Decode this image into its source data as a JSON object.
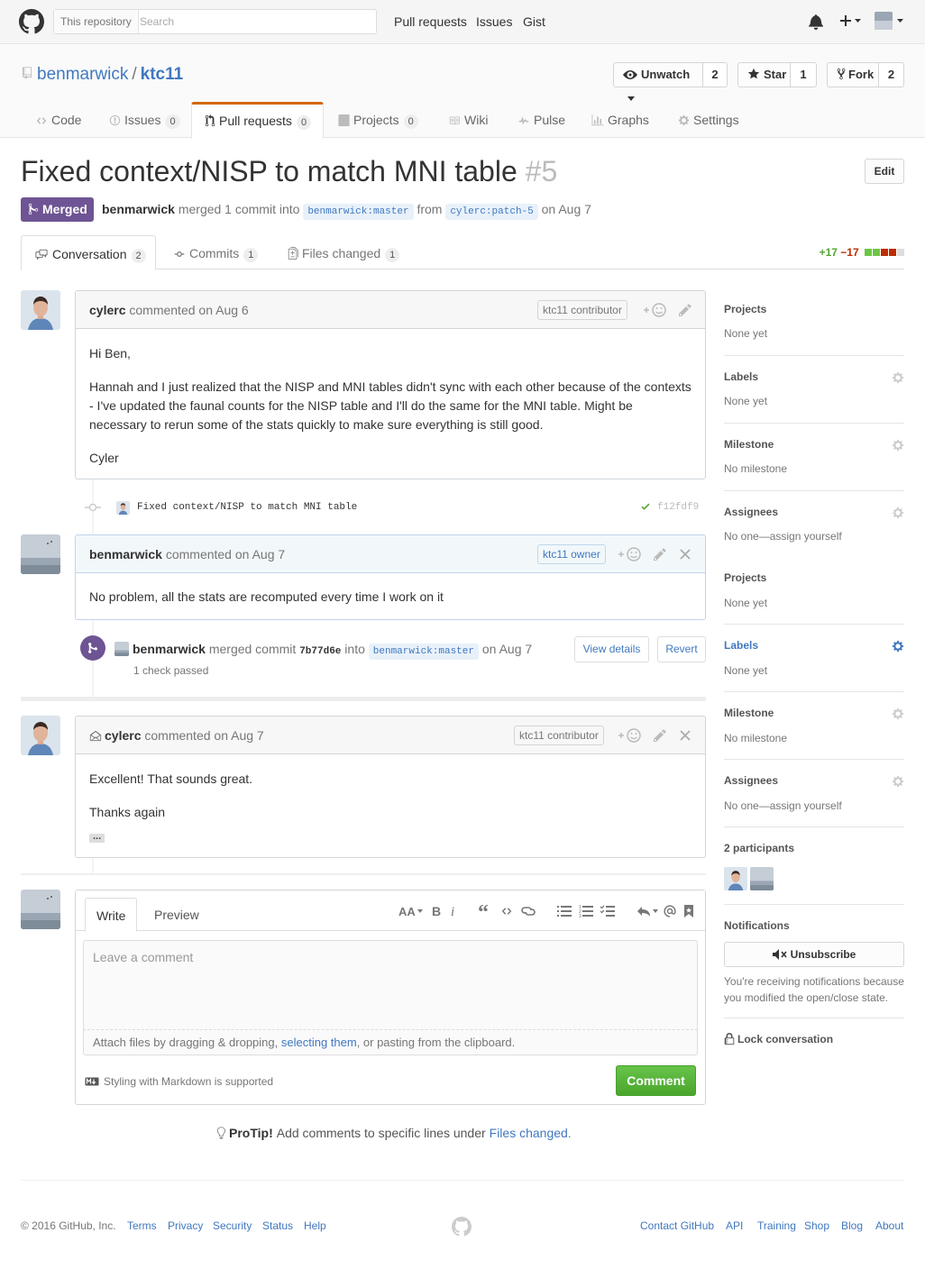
{
  "header": {
    "scope_label": "This repository",
    "search_placeholder": "Search",
    "nav": [
      "Pull requests",
      "Issues",
      "Gist"
    ]
  },
  "repo": {
    "owner": "benmarwick",
    "separator": "/",
    "name": "ktc11",
    "unwatch_label": "Unwatch",
    "watch_count": "2",
    "star_label": "Star",
    "star_count": "1",
    "fork_label": "Fork",
    "fork_count": "2",
    "tabs": [
      {
        "label": "Code"
      },
      {
        "label": "Issues",
        "count": "0"
      },
      {
        "label": "Pull requests",
        "count": "0"
      },
      {
        "label": "Projects",
        "count": "0"
      },
      {
        "label": "Wiki"
      },
      {
        "label": "Pulse"
      },
      {
        "label": "Graphs"
      },
      {
        "label": "Settings"
      }
    ]
  },
  "pr": {
    "title": "Fixed context/NISP to match MNI table",
    "number": "#5",
    "edit_label": "Edit",
    "state": "Merged",
    "merger": "benmarwick",
    "merged_text": "merged 1 commit into",
    "base_branch": "benmarwick:master",
    "from_text": "from",
    "head_branch": "cylerc:patch-5",
    "date_text": "on Aug 7",
    "tabs": [
      {
        "label": "Conversation",
        "count": "2"
      },
      {
        "label": "Commits",
        "count": "1"
      },
      {
        "label": "Files changed",
        "count": "1"
      }
    ],
    "additions": "+17",
    "deletions": "−17"
  },
  "timeline": {
    "comment1": {
      "author": "cylerc",
      "action": "commented",
      "time": "on Aug 6",
      "role": "ktc11 contributor",
      "paragraphs": [
        "Hi Ben,",
        "Hannah and I just realized that the NISP and MNI tables didn't sync with each other because of the contexts - I've updated the faunal counts for the NISP table and I'll do the same for the MNI table. Might be necessary to rerun some of the stats quickly to make sure everything is still good.",
        "Cyler"
      ]
    },
    "commit": {
      "message": "Fixed context/NISP to match MNI table",
      "sha": "f12fdf9"
    },
    "comment2": {
      "author": "benmarwick",
      "action": "commented",
      "time": "on Aug 7",
      "role": "ktc11 owner",
      "body": "No problem, all the stats are recomputed every time I work on it"
    },
    "merge": {
      "user": "benmarwick",
      "text": "merged commit",
      "sha": "7b77d6e",
      "into": "into",
      "branch": "benmarwick:master",
      "date": "on Aug 7",
      "checks": "1 check passed",
      "view_details": "View details",
      "revert": "Revert"
    },
    "comment3": {
      "author": "cylerc",
      "action": "commented",
      "time": "on Aug 7",
      "role": "ktc11 contributor",
      "line1": "Excellent! That sounds great.",
      "line2": "Thanks again",
      "ellipsis": "..."
    }
  },
  "form": {
    "write_tab": "Write",
    "preview_tab": "Preview",
    "placeholder": "Leave a comment",
    "attach_pre": "Attach files by dragging & dropping, ",
    "attach_link": "selecting them",
    "attach_post": ", or pasting from the clipboard.",
    "markdown_note": "Styling with Markdown is supported",
    "submit": "Comment"
  },
  "protip": {
    "label": "ProTip!",
    "text": "Add comments to specific lines under",
    "link": "Files changed."
  },
  "sidebar": {
    "projects_label": "Projects",
    "projects_value": "None yet",
    "labels_label": "Labels",
    "labels_value": "None yet",
    "milestone_label": "Milestone",
    "milestone_value": "No milestone",
    "assignees_label": "Assignees",
    "assignees_value": "No one—assign yourself",
    "participants_label": "2 participants",
    "notifications_label": "Notifications",
    "unsubscribe_label": "Unsubscribe",
    "notifications_reason": "You're receiving notifications because you modified the open/close state.",
    "lock_label": "Lock conversation"
  },
  "footer": {
    "copyright": "© 2016 GitHub, Inc.",
    "left_links": [
      "Terms",
      "Privacy",
      "Security",
      "Status",
      "Help"
    ],
    "right_links": [
      "Contact GitHub",
      "API",
      "Training",
      "Shop",
      "Blog",
      "About"
    ]
  },
  "colors": {
    "link": "#4078c0",
    "merged": "#6e5494",
    "accent_tab": "#d26911",
    "addition": "#55a532",
    "deletion": "#bd2c00"
  }
}
